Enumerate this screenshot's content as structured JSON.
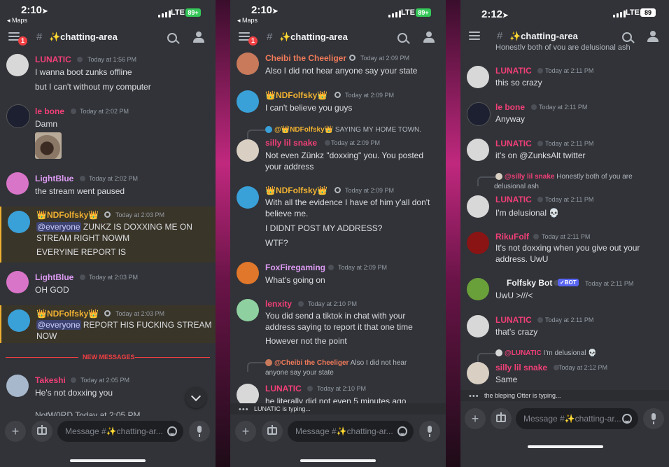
{
  "panels": [
    {
      "time": "2:10",
      "back": "◂ Maps",
      "net": "LTE",
      "battery": "89+",
      "channel": "✨chatting-area",
      "notif": "1",
      "placeholder": "Message #✨chatting-ar...",
      "new_messages": "NEW MESSAGES",
      "messages": [
        {
          "user": "LUNATIC",
          "color": "#f23f77",
          "time": "Today at 1:56 PM",
          "lines": [
            "I wanna boot zunks offline",
            "but I can't without my computer"
          ],
          "avatar": "#d8d8d8"
        },
        {
          "user": "le bone",
          "color": "#f23f77",
          "time": "Today at 2:02 PM",
          "lines": [
            "Damn"
          ],
          "avatar": "#1c2030"
        },
        {
          "user": "LightBlue",
          "color": "#dc9af2",
          "time": "Today at 2:02 PM",
          "lines": [
            "the stream went paused"
          ],
          "avatar": "#d975c9"
        },
        {
          "user": "👑NDFolfsky👑",
          "color": "#f0b132",
          "time": "Today at 2:03 PM",
          "mention": "@everyone",
          "lines": [
            " ZUNKZ IS DOXXING ME ON",
            "STREAM RIGHT NOWM",
            "EVERYINE REPORT IS"
          ],
          "avatar": "#3aa0d8"
        },
        {
          "user": "LightBlue",
          "color": "#dc9af2",
          "time": "Today at 2:03 PM",
          "lines": [
            "OH GOD"
          ],
          "avatar": "#d975c9"
        },
        {
          "user": "👑NDFolfsky👑",
          "color": "#f0b132",
          "time": "Today at 2:03 PM",
          "mention": "@everyone",
          "lines": [
            " REPORT HIS FUCKING STREAM",
            "NOW"
          ],
          "avatar": "#3aa0d8"
        },
        {
          "user": "Takeshi",
          "color": "#f23f77",
          "time": "Today at 2:05 PM",
          "lines": [
            "He's not doxxing you"
          ],
          "avatar": "#a7b8cc"
        }
      ],
      "cut_text": "NotW0RD  Today at 2:05 PM"
    },
    {
      "time": "2:10",
      "back": "◂ Maps",
      "net": "LTE",
      "battery": "89+",
      "channel": "✨chatting-area",
      "notif": "1",
      "placeholder": "Message #✨chatting-ar...",
      "typing": "LUNATIC is typing...",
      "messages": [
        {
          "user": "Cheibi the Cheeliger",
          "color": "#f27a5a",
          "time": "Today at 2:09 PM",
          "lines": [
            "Also I did not hear anyone say your state"
          ],
          "avatar": "#c97a5b"
        },
        {
          "user": "👑NDFolfsky👑",
          "color": "#f0b132",
          "time": "Today at 2:09 PM",
          "lines": [
            "I can't believe you guys"
          ],
          "avatar": "#3aa0d8"
        },
        {
          "reply_user": "@👑NDFolfsky👑",
          "reply_text": "SAYING MY HOME TOWN.",
          "user": "silly lil snake",
          "color": "#f23f77",
          "time": "Today at 2:09 PM",
          "lines": [
            "Not even Zünkz \"doxxing\" you. You posted",
            "your address"
          ],
          "avatar": "#d9cfc3"
        },
        {
          "user": "👑NDFolfsky👑",
          "color": "#f0b132",
          "time": "Today at 2:09 PM",
          "lines": [
            "With all the evidence I have of him y'all don't",
            "believe me.",
            "I DIDNT POST MY ADDRESS?",
            "WTF?"
          ],
          "avatar": "#3aa0d8"
        },
        {
          "user": "FoxFiregaming",
          "color": "#dc9af2",
          "time": "Today at 2:09 PM",
          "lines": [
            "What's going on"
          ],
          "avatar": "#e0772a"
        },
        {
          "user": "lenxity",
          "color": "#f23f77",
          "time": "Today at 2:10 PM",
          "lines": [
            "You did send a tiktok in chat with your",
            "address saying to report it that one time",
            "However not the point"
          ],
          "avatar": "#8fd0a0"
        },
        {
          "reply_user": "@Cheibi the Cheeliger",
          "reply_text": "Also I did not hear",
          "reply_text2": "anyone say your state",
          "user": "LUNATIC",
          "color": "#f23f77",
          "time": "Today at 2:10 PM",
          "lines": [
            "he literally did not even 5 minutes ago"
          ],
          "avatar": "#d8d8d8"
        }
      ]
    },
    {
      "time": "2:12",
      "net": "LTE",
      "battery": "89",
      "channel": "✨chatting-area",
      "placeholder": "Message #✨chatting-ar...",
      "typing": "the bleping Otter is typing...",
      "top_cut": "Honestly both of you are delusional ash",
      "messages": [
        {
          "user": "LUNATIC",
          "color": "#f23f77",
          "time": "Today at 2:11 PM",
          "lines": [
            "this so crazy"
          ],
          "avatar": "#d8d8d8"
        },
        {
          "user": "le bone",
          "color": "#f23f77",
          "time": "Today at 2:11 PM",
          "lines": [
            "Anyway"
          ],
          "avatar": "#1c2030"
        },
        {
          "user": "LUNATIC",
          "color": "#f23f77",
          "time": "Today at 2:11 PM",
          "lines": [
            "it's on @ZunksAlt twitter"
          ],
          "avatar": "#d8d8d8"
        },
        {
          "reply_user": "@silly lil snake",
          "reply_text": "Honestly both of you are",
          "reply_text2": "delusional ash",
          "user": "LUNATIC",
          "color": "#f23f77",
          "time": "Today at 2:11 PM",
          "lines": [
            "I'm delusional 💀"
          ],
          "avatar": "#d8d8d8"
        },
        {
          "user": "RikuFolf",
          "color": "#f23f77",
          "time": "Today at 2:11 PM",
          "lines": [
            "It's not doxxing when you give out your",
            "address. UwU"
          ],
          "avatar": "#8a1414"
        },
        {
          "user": "Folfsky Bot",
          "color": "#f2f3f5",
          "bot": "✓BOT",
          "time": "Today at 2:11 PM",
          "lines": [
            "UwU >///<"
          ],
          "avatar": "#6aa03a"
        },
        {
          "user": "LUNATIC",
          "color": "#f23f77",
          "time": "Today at 2:11 PM",
          "lines": [
            "that's crazy"
          ],
          "avatar": "#d8d8d8"
        },
        {
          "reply_user": "@LUNATIC",
          "reply_text": "I'm delusional 💀",
          "user": "silly lil snake",
          "color": "#f23f77",
          "time": "Today at 2:12 PM",
          "lines": [
            "Same"
          ],
          "avatar": "#d9cfc3"
        }
      ]
    }
  ],
  "colors": {
    "bg": "#313338",
    "input": "#1e1f22",
    "accent": "#5865f2",
    "new": "#f23f43"
  }
}
